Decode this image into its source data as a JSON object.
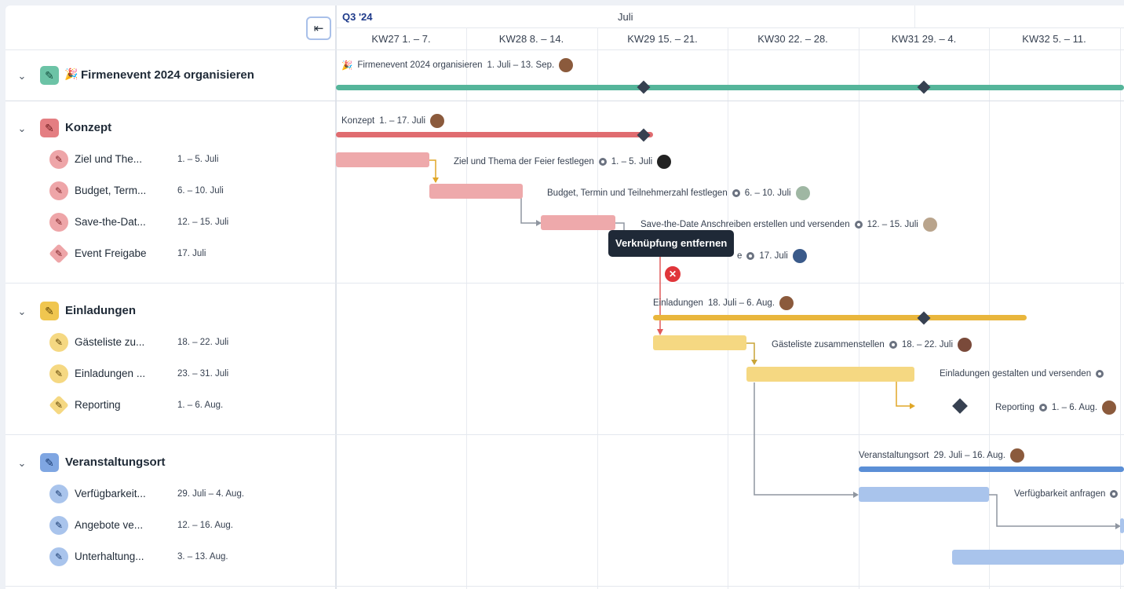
{
  "header": {
    "quarter": "Q3 '24",
    "month": "Juli",
    "weeks": [
      "KW27 1. – 7.",
      "KW28 8. – 14.",
      "KW29 15. – 21.",
      "KW30 22. – 28.",
      "KW31 29. – 4.",
      "KW32 5. – 11."
    ]
  },
  "project": {
    "title": "Firmenevent 2024 organisieren",
    "emoji": "🎉",
    "bar_label": "Firmenevent 2024 organisieren",
    "bar_dates": "1. Juli – 13. Sep."
  },
  "groups": [
    {
      "title": "Konzept",
      "bar_label": "Konzept",
      "bar_dates": "1. – 17. Juli",
      "tasks": [
        {
          "name": "Ziel und The...",
          "date": "1. – 5. Juli",
          "full": "Ziel und Thema der Feier festlegen"
        },
        {
          "name": "Budget, Term...",
          "date": "6. – 10. Juli",
          "full": "Budget, Termin und Teilnehmerzahl festlegen"
        },
        {
          "name": "Save-the-Dat...",
          "date": "12. – 15. Juli",
          "full": "Save-the-Date Anschreiben erstellen und versenden"
        },
        {
          "name": "Event Freigabe",
          "date": "17. Juli",
          "full": "e"
        }
      ]
    },
    {
      "title": "Einladungen",
      "bar_label": "Einladungen",
      "bar_dates": "18. Juli – 6. Aug.",
      "tasks": [
        {
          "name": "Gästeliste zu...",
          "date": "18. – 22. Juli",
          "full": "Gästeliste zusammenstellen"
        },
        {
          "name": "Einladungen ...",
          "date": "23. – 31. Juli",
          "full": "Einladungen gestalten und versenden"
        },
        {
          "name": "Reporting",
          "date": "1. – 6. Aug.",
          "full": "Reporting"
        }
      ]
    },
    {
      "title": "Veranstaltungsort",
      "bar_label": "Veranstaltungsort",
      "bar_dates": "29. Juli – 16. Aug.",
      "tasks": [
        {
          "name": "Verfügbarkeit...",
          "date": "29. Juli – 4. Aug.",
          "full": "Verfügbarkeit anfragen"
        },
        {
          "name": "Angebote ve...",
          "date": "12. – 16. Aug."
        },
        {
          "name": "Unterhaltung...",
          "date": "3. – 13. Aug."
        }
      ]
    }
  ],
  "tooltip": "Verknüpfung entfernen",
  "colors": {
    "project": "#55b59a",
    "konzept": "#e06c70",
    "konzept_light": "#eea9ab",
    "einladungen": "#e9b63c",
    "einladungen_light": "#f5d882",
    "venue": "#5b8fd6",
    "venue_light": "#a9c4ec"
  },
  "icons": {
    "collapse": "collapse-left-icon",
    "task": "pencil-icon",
    "group_toggle": "chevron-down-icon"
  }
}
